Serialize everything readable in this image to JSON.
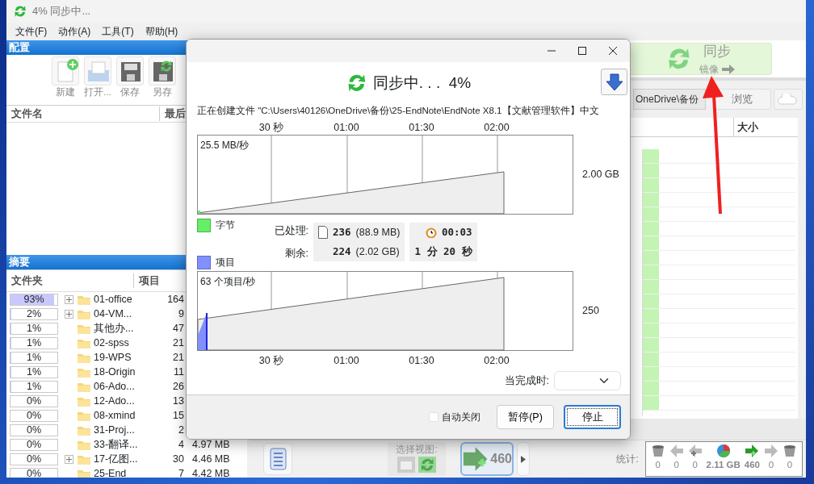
{
  "main_window": {
    "title": "4% 同步中...",
    "menu": [
      "文件(F)",
      "动作(A)",
      "工具(T)",
      "帮助(H)"
    ]
  },
  "config_panel": {
    "title": "配置",
    "toolbar": [
      {
        "kind": "new",
        "label": "新建"
      },
      {
        "kind": "open",
        "label": "打开..."
      },
      {
        "kind": "save",
        "label": "保存"
      },
      {
        "kind": "saveas",
        "label": "另存"
      }
    ],
    "columns": [
      "文件名",
      "最后"
    ]
  },
  "summary_panel": {
    "title": "摘要",
    "columns": [
      "文件夹",
      "项目"
    ],
    "rows": [
      {
        "percent": "93%",
        "level": 0.93,
        "has_children": true,
        "name": "01-office",
        "items": "164"
      },
      {
        "percent": "2%",
        "level": 0.02,
        "has_children": true,
        "name": "04-VM...",
        "items": "9"
      },
      {
        "percent": "1%",
        "level": 0.01,
        "has_children": false,
        "name": "其他办...",
        "items": "47"
      },
      {
        "percent": "1%",
        "level": 0.01,
        "has_children": false,
        "name": "02-spss",
        "items": "21"
      },
      {
        "percent": "1%",
        "level": 0.01,
        "has_children": false,
        "name": "19-WPS",
        "items": "21"
      },
      {
        "percent": "1%",
        "level": 0.01,
        "has_children": false,
        "name": "18-Origin",
        "items": "11"
      },
      {
        "percent": "1%",
        "level": 0.01,
        "has_children": false,
        "name": "06-Ado...",
        "items": "26"
      },
      {
        "percent": "0%",
        "level": 0,
        "has_children": false,
        "name": "12-Ado...",
        "items": "13"
      },
      {
        "percent": "0%",
        "level": 0,
        "has_children": false,
        "name": "08-xmind",
        "items": "15"
      },
      {
        "percent": "0%",
        "level": 0,
        "has_children": false,
        "name": "31-Proj...",
        "items": "2"
      },
      {
        "percent": "0%",
        "level": 0,
        "has_children": false,
        "name": "33-翻译...",
        "items": "4",
        "size": "4.97 MB"
      },
      {
        "percent": "0%",
        "level": 0,
        "has_children": true,
        "name": "17-亿图...",
        "items": "30",
        "size": "4.46 MB"
      },
      {
        "percent": "0%",
        "level": 0,
        "has_children": false,
        "name": "25-End",
        "items": "7",
        "size": "4.42 MB"
      }
    ]
  },
  "right_pane": {
    "sync_button": {
      "label": "同步",
      "sublabel": "镜像"
    },
    "path": "OneDrive\\备份",
    "browse": "浏览",
    "columns": [
      "大小"
    ]
  },
  "bottom_bar": {
    "view_label": "选择视图:",
    "count": "460",
    "stats_label": "统计:",
    "stats": [
      {
        "kind": "trash",
        "value": "0"
      },
      {
        "kind": "left",
        "value": "0"
      },
      {
        "kind": "addleft",
        "value": "0"
      },
      {
        "kind": "pie",
        "value": "2.11 GB"
      },
      {
        "kind": "addright",
        "value": "460"
      },
      {
        "kind": "right",
        "value": "0"
      },
      {
        "kind": "trash",
        "value": "0"
      }
    ]
  },
  "dialog": {
    "title": "同步中. . .  4%",
    "status": "正在创建文件 \"C:\\Users\\40126\\OneDrive\\备份\\25-EndNote\\EndNote X8.1【文献管理软件】中文",
    "top_axis": [
      "30 秒",
      "01:00",
      "01:30",
      "02:00"
    ],
    "bytes_chart": {
      "rate": "25.5 MB/秒",
      "total": "2.00 GB"
    },
    "legend": [
      {
        "label": "字节",
        "color": "#66ee66"
      },
      {
        "label": "项目",
        "color": "#8090ff"
      }
    ],
    "processed": {
      "label": "已处理:",
      "count": "236",
      "size": "(88.9 MB)"
    },
    "remaining": {
      "label": "剩余:",
      "count": "224",
      "size": "(2.02 GB)"
    },
    "elapsed": "00:03",
    "remaining_time": "1 分 20 秒",
    "items_chart": {
      "rate": "63 个项目/秒",
      "total": "250"
    },
    "bottom_axis": [
      "30 秒",
      "01:00",
      "01:30",
      "02:00"
    ],
    "when_done_label": "当完成时:",
    "auto_close": {
      "label": "自动关闭",
      "checked": false
    },
    "buttons": [
      {
        "label": "暂停(P)",
        "focused": false
      },
      {
        "label": "停止",
        "focused": true
      }
    ]
  }
}
